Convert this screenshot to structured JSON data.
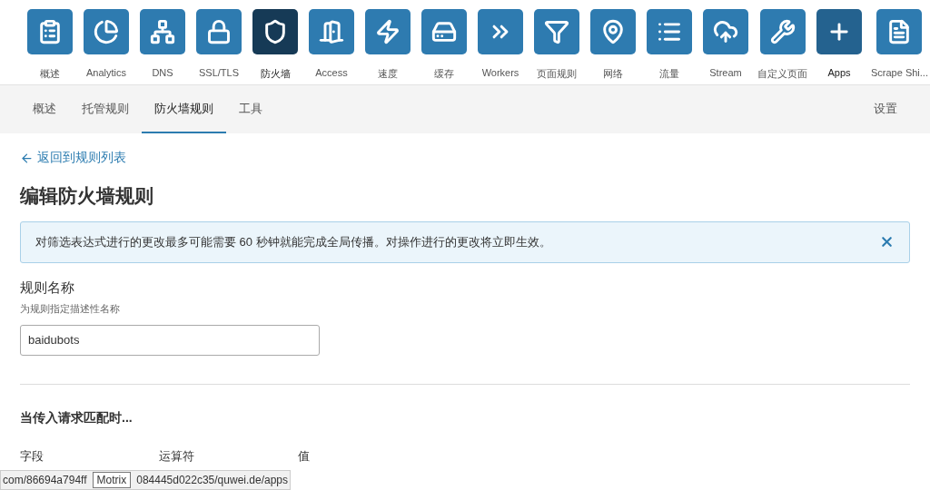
{
  "app_nav": [
    {
      "label": "概述",
      "selected": false,
      "hovered": false
    },
    {
      "label": "Analytics",
      "selected": false,
      "hovered": false
    },
    {
      "label": "DNS",
      "selected": false,
      "hovered": false
    },
    {
      "label": "SSL/TLS",
      "selected": false,
      "hovered": false
    },
    {
      "label": "防火墙",
      "selected": true,
      "hovered": false
    },
    {
      "label": "Access",
      "selected": false,
      "hovered": false
    },
    {
      "label": "速度",
      "selected": false,
      "hovered": false
    },
    {
      "label": "缓存",
      "selected": false,
      "hovered": false
    },
    {
      "label": "Workers",
      "selected": false,
      "hovered": false
    },
    {
      "label": "页面规则",
      "selected": false,
      "hovered": false
    },
    {
      "label": "网络",
      "selected": false,
      "hovered": false
    },
    {
      "label": "流量",
      "selected": false,
      "hovered": false
    },
    {
      "label": "Stream",
      "selected": false,
      "hovered": false
    },
    {
      "label": "自定义页面",
      "selected": false,
      "hovered": false
    },
    {
      "label": "Apps",
      "selected": false,
      "hovered": true
    },
    {
      "label": "Scrape Shi...",
      "selected": false,
      "hovered": false
    }
  ],
  "sub_tabs": [
    {
      "label": "概述",
      "selected": false
    },
    {
      "label": "托管规则",
      "selected": false
    },
    {
      "label": "防火墙规则",
      "selected": true
    },
    {
      "label": "工具",
      "selected": false
    }
  ],
  "settings_link": "设置",
  "back_link": "返回到规则列表",
  "page_title": "编辑防火墙规则",
  "notice": "对筛选表达式进行的更改最多可能需要 60 秒钟就能完成全局传播。对操作进行的更改将立即生效。",
  "rule_name": {
    "label": "规则名称",
    "hint": "为规则指定描述性名称",
    "value": "baidubots"
  },
  "match_section": {
    "title": "当传入请求匹配时...",
    "columns": [
      "字段",
      "运算符",
      "值"
    ]
  },
  "status_url": {
    "before": "com/86694a794ff",
    "after": "084445d022c35/quwei.de/apps"
  },
  "tooltip": "Motrix"
}
